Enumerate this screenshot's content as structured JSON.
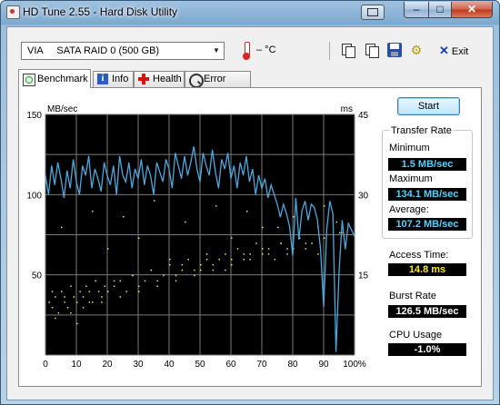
{
  "window": {
    "title": "HD Tune 2.55 - Hard Disk Utility"
  },
  "toolbar": {
    "drive": "VIA     SATA RAID 0 (500 GB)",
    "temperature": "– °C",
    "exit_label": "Exit"
  },
  "tabs": [
    {
      "label": "Benchmark",
      "icon": "benchmark-icon",
      "active": true
    },
    {
      "label": "Info",
      "icon": "info-icon"
    },
    {
      "label": "Health",
      "icon": "health-cross-icon"
    },
    {
      "label": "Error Scan",
      "icon": "magnifier-icon"
    }
  ],
  "buttons": {
    "start": "Start"
  },
  "stats": {
    "transfer_rate_title": "Transfer Rate",
    "minimum_label": "Minimum",
    "minimum_value": "1.5 MB/sec",
    "maximum_label": "Maximum",
    "maximum_value": "134.1 MB/sec",
    "average_label": "Average:",
    "average_value": "107.2 MB/sec",
    "access_time_label": "Access Time:",
    "access_time_value": "14.8 ms",
    "burst_rate_label": "Burst Rate",
    "burst_rate_value": "126.5 MB/sec",
    "cpu_usage_label": "CPU Usage",
    "cpu_usage_value": "-1.0%"
  },
  "colors": {
    "transfer_line": "#4aa8e0",
    "access_dots": "#e8e860",
    "grid": "#7a7a7a",
    "plot_bg": "#000000"
  },
  "chart_data": {
    "type": "line",
    "xlabel": "",
    "x_ticks": [
      "0",
      "10",
      "20",
      "30",
      "40",
      "50",
      "60",
      "70",
      "80",
      "90",
      "100%"
    ],
    "left_axis_unit": "MB/sec",
    "right_axis_unit": "ms",
    "left_ticks": [
      "150",
      "100",
      "50"
    ],
    "right_ticks": [
      "45",
      "30",
      "15"
    ],
    "ylim_left": [
      0,
      150
    ],
    "ylim_right": [
      0,
      45
    ],
    "grid": true,
    "series": [
      {
        "name": "",
        "x": [
          0,
          1,
          2,
          3,
          4,
          5,
          6,
          7,
          8,
          9,
          10,
          11,
          12,
          13,
          14,
          15,
          16,
          17,
          18,
          19,
          20,
          21,
          22,
          23,
          24,
          25,
          26,
          27,
          28,
          29,
          30,
          31,
          32,
          33,
          34,
          35,
          36,
          37,
          38,
          39,
          40,
          41,
          42,
          43,
          44,
          45,
          46,
          47,
          48,
          49,
          50,
          51,
          52,
          53,
          54,
          55,
          56,
          57,
          58,
          59,
          60,
          61,
          62,
          63,
          64,
          65,
          66,
          67,
          68,
          69,
          70,
          71,
          72,
          73,
          74,
          75,
          76,
          77,
          78,
          79,
          80,
          81,
          82,
          83,
          84,
          85,
          86,
          87,
          88,
          89,
          90,
          91,
          92,
          93,
          94,
          95,
          96,
          97,
          98,
          99,
          100
        ],
        "values": [
          112,
          100,
          118,
          106,
          120,
          110,
          98,
          115,
          104,
          122,
          108,
          100,
          118,
          112,
          124,
          104,
          116,
          110,
          102,
          120,
          112,
          106,
          118,
          100,
          124,
          112,
          108,
          120,
          104,
          116,
          110,
          122,
          106,
          118,
          112,
          100,
          120,
          114,
          108,
          122,
          116,
          104,
          126,
          118,
          110,
          124,
          112,
          120,
          130,
          116,
          108,
          126,
          118,
          112,
          128,
          114,
          104,
          122,
          116,
          126,
          110,
          118,
          104,
          120,
          112,
          124,
          108,
          116,
          100,
          112,
          104,
          110,
          98,
          106,
          100,
          94,
          86,
          94,
          88,
          80,
          62,
          98,
          72,
          90,
          96,
          84,
          94,
          92,
          84,
          66,
          30,
          78,
          96,
          88,
          2,
          52,
          84,
          66,
          82,
          78,
          74
        ]
      }
    ],
    "scatter_series": {
      "name": "",
      "axis": "right",
      "x": [
        1,
        2,
        3,
        4,
        5,
        6,
        7,
        8,
        9,
        10,
        11,
        12,
        13,
        14,
        15,
        16,
        17,
        18,
        19,
        20,
        22,
        24,
        26,
        28,
        30,
        32,
        34,
        36,
        38,
        40,
        42,
        44,
        46,
        48,
        50,
        52,
        54,
        56,
        58,
        60,
        62,
        64,
        66,
        68,
        70,
        72,
        74,
        76,
        78,
        80,
        82,
        84,
        86,
        88,
        90,
        3,
        8,
        12,
        18,
        24,
        30,
        36,
        42,
        48,
        54,
        60,
        66,
        72,
        78,
        84,
        90,
        96,
        5,
        15,
        25,
        35,
        45,
        55,
        65,
        75,
        85,
        95,
        10,
        20,
        30,
        40,
        50,
        60,
        70,
        80,
        90,
        2,
        6,
        14,
        22,
        28,
        34,
        44,
        52,
        58,
        64,
        70,
        76,
        82,
        88,
        94
      ],
      "values": [
        10,
        9,
        11,
        8,
        12,
        10,
        9,
        13,
        11,
        10,
        12,
        11,
        13,
        12,
        10,
        14,
        12,
        11,
        13,
        12,
        13,
        14,
        12,
        15,
        13,
        14,
        16,
        14,
        15,
        17,
        15,
        16,
        18,
        16,
        17,
        19,
        17,
        18,
        19,
        18,
        20,
        18,
        19,
        21,
        19,
        20,
        18,
        21,
        19,
        20,
        22,
        20,
        21,
        19,
        22,
        7,
        8,
        9,
        10,
        11,
        12,
        13,
        14,
        15,
        16,
        17,
        18,
        19,
        20,
        21,
        22,
        23,
        24,
        27,
        26,
        29,
        25,
        28,
        27,
        24,
        26,
        23,
        6,
        20,
        22,
        18,
        16,
        22,
        24,
        26,
        28,
        12,
        11,
        10,
        14,
        15,
        16,
        17,
        18,
        16,
        19,
        20,
        21,
        22,
        24,
        25
      ]
    }
  }
}
